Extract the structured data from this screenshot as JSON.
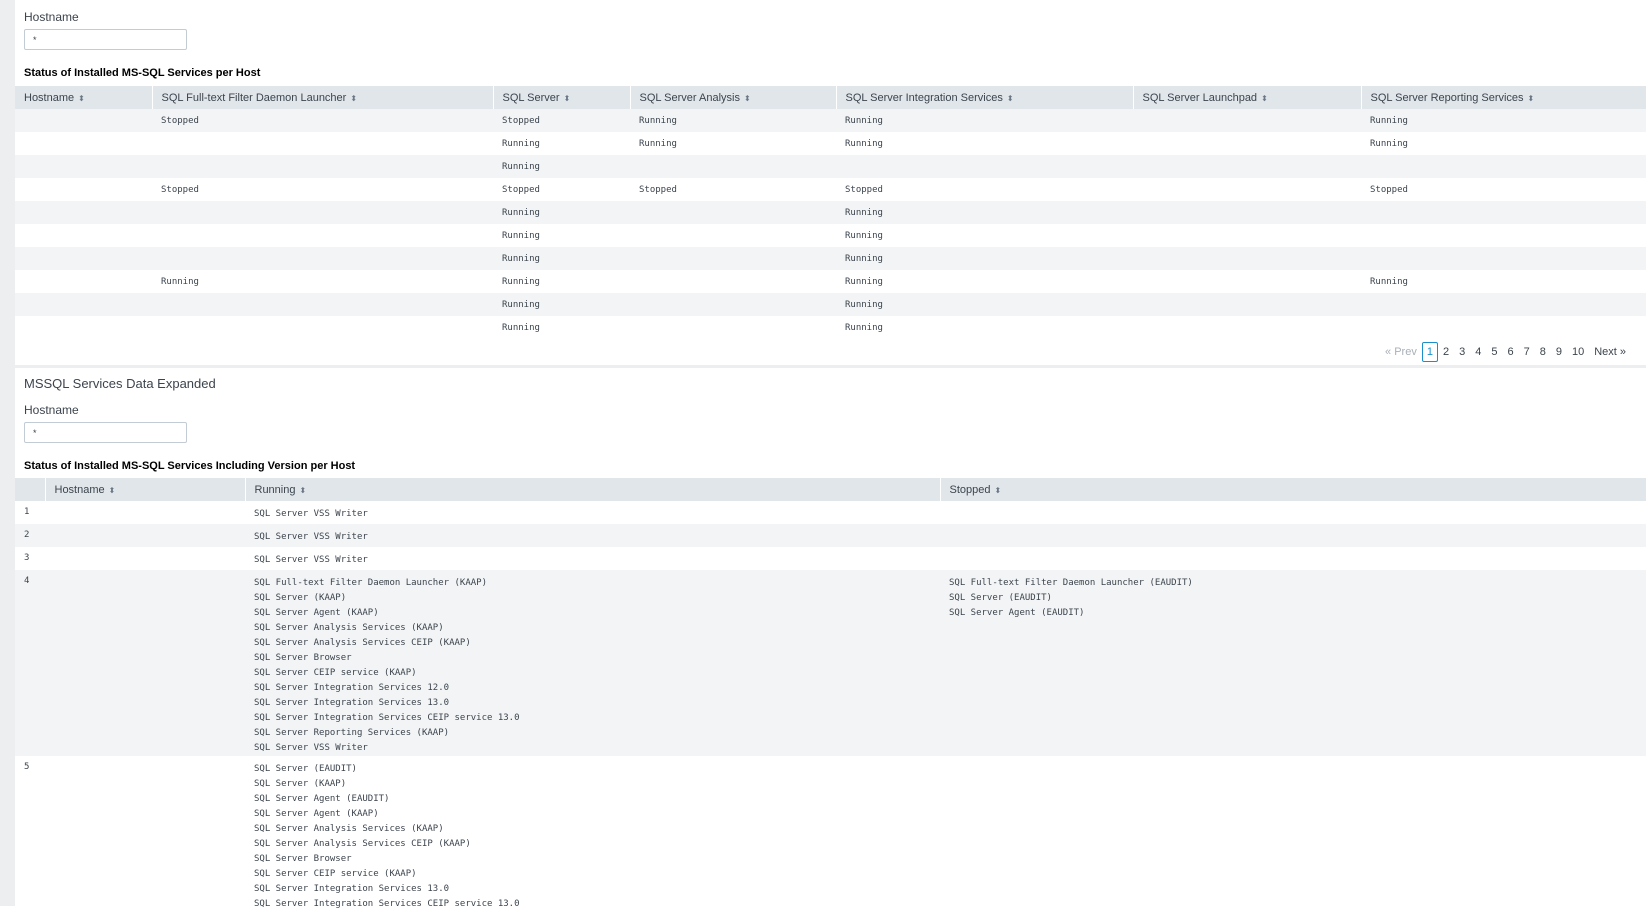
{
  "panel1": {
    "filter_label": "Hostname",
    "filter_value": "*",
    "table_title": "Status of Installed MS-SQL Services per Host",
    "columns": [
      "Hostname",
      "SQL Full-text Filter Daemon Launcher",
      "SQL Server",
      "SQL Server Analysis",
      "SQL Server Integration Services",
      "SQL Server Launchpad",
      "SQL Server Reporting Services"
    ],
    "rows": [
      [
        "",
        "Stopped",
        "Stopped",
        "Running",
        "Running",
        "",
        "Running"
      ],
      [
        "",
        "",
        "Running",
        "Running",
        "Running",
        "",
        "Running"
      ],
      [
        "",
        "",
        "Running",
        "",
        "",
        "",
        ""
      ],
      [
        "",
        "Stopped",
        "Stopped",
        "Stopped",
        "Stopped",
        "",
        "Stopped"
      ],
      [
        "",
        "",
        "Running",
        "",
        "Running",
        "",
        ""
      ],
      [
        "",
        "",
        "Running",
        "",
        "Running",
        "",
        ""
      ],
      [
        "",
        "",
        "Running",
        "",
        "Running",
        "",
        ""
      ],
      [
        "",
        "Running",
        "Running",
        "",
        "Running",
        "",
        "Running"
      ],
      [
        "",
        "",
        "Running",
        "",
        "Running",
        "",
        ""
      ],
      [
        "",
        "",
        "Running",
        "",
        "Running",
        "",
        ""
      ]
    ],
    "pager": {
      "prev": "« Prev",
      "pages": [
        "1",
        "2",
        "3",
        "4",
        "5",
        "6",
        "7",
        "8",
        "9",
        "10"
      ],
      "current": "1",
      "next": "Next »"
    }
  },
  "panel2": {
    "title": "MSSQL Services Data Expanded",
    "filter_label": "Hostname",
    "filter_value": "*",
    "table_title": "Status of Installed MS-SQL Services Including Version per Host",
    "columns": [
      "",
      "Hostname",
      "Running",
      "Stopped"
    ],
    "rows": [
      {
        "num": "1",
        "hostname": "",
        "running": [
          "SQL Server VSS Writer"
        ],
        "stopped": []
      },
      {
        "num": "2",
        "hostname": "",
        "running": [
          "SQL Server VSS Writer"
        ],
        "stopped": []
      },
      {
        "num": "3",
        "hostname": "",
        "running": [
          "SQL Server VSS Writer"
        ],
        "stopped": []
      },
      {
        "num": "4",
        "hostname": "",
        "running": [
          "SQL Full-text Filter Daemon Launcher (KAAP)",
          "SQL Server (KAAP)",
          "SQL Server Agent (KAAP)",
          "SQL Server Analysis Services (KAAP)",
          "SQL Server Analysis Services CEIP (KAAP)",
          "SQL Server Browser",
          "SQL Server CEIP service (KAAP)",
          "SQL Server Integration Services 12.0",
          "SQL Server Integration Services 13.0",
          "SQL Server Integration Services CEIP service 13.0",
          "SQL Server Reporting Services (KAAP)",
          "SQL Server VSS Writer"
        ],
        "stopped": [
          "SQL Full-text Filter Daemon Launcher (EAUDIT)",
          "SQL Server (EAUDIT)",
          "SQL Server Agent (EAUDIT)"
        ]
      },
      {
        "num": "5",
        "hostname": "",
        "running": [
          "SQL Server (EAUDIT)",
          "SQL Server (KAAP)",
          "SQL Server Agent (EAUDIT)",
          "SQL Server Agent (KAAP)",
          "SQL Server Analysis Services (KAAP)",
          "SQL Server Analysis Services CEIP (KAAP)",
          "SQL Server Browser",
          "SQL Server CEIP service (KAAP)",
          "SQL Server Integration Services 13.0",
          "SQL Server Integration Services CEIP service 13.0"
        ],
        "stopped": []
      }
    ]
  }
}
